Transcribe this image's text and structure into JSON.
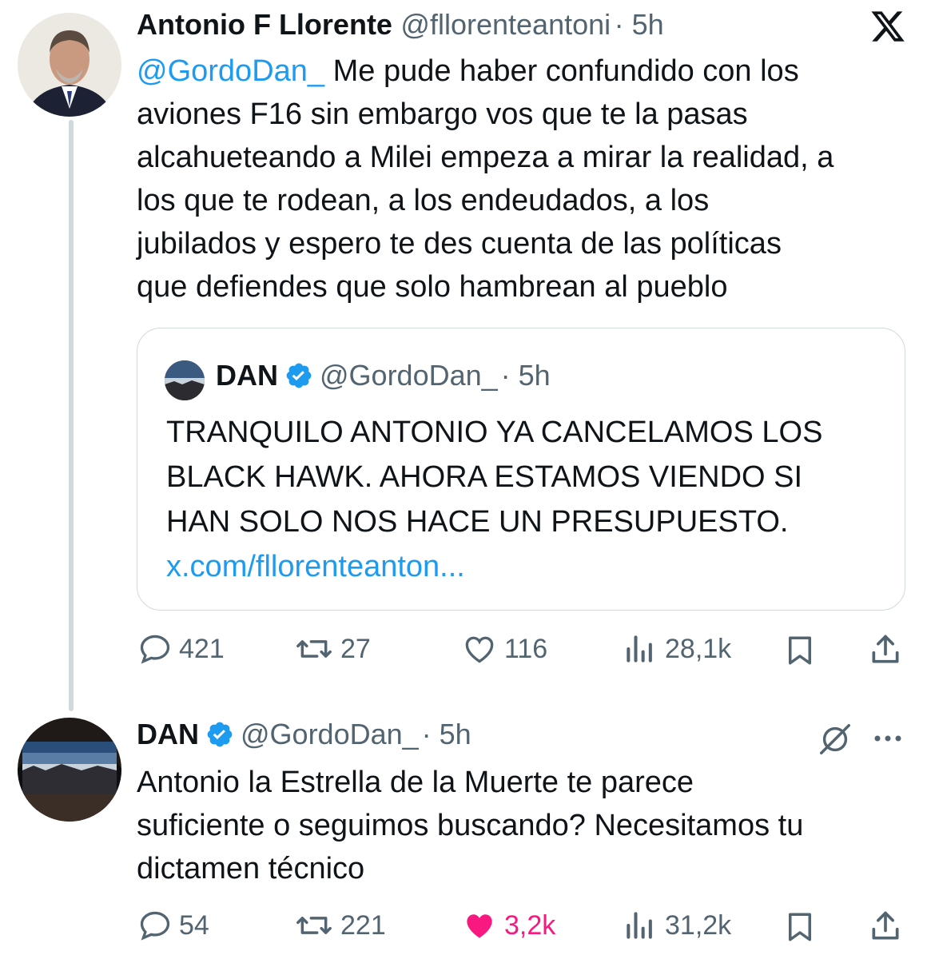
{
  "tweet1": {
    "name": "Antonio F Llorente",
    "handle": "@fllorenteantoni",
    "time": "· 5h",
    "mention": "@GordoDan_",
    "lines": [
      "Me pude haber confundido con los",
      "aviones F16 sin embargo vos que te la pasas",
      "alcahueteando a Milei empeza a mirar la realidad, a",
      "los que te rodean, a los endeudados, a los",
      "jubilados y espero te des cuenta de las políticas",
      "que defiendes que solo hambrean al pueblo"
    ],
    "quote": {
      "name": "DAN",
      "handle": "@GordoDan_",
      "time": "· 5h",
      "lines": [
        "TRANQUILO ANTONIO YA CANCELAMOS LOS",
        "BLACK HAWK. AHORA ESTAMOS VIENDO SI",
        "HAN SOLO NOS HACE UN PRESUPUESTO."
      ],
      "link": "x.com/fllorenteanton..."
    },
    "actions": {
      "replies": "421",
      "reposts": "27",
      "likes": "116",
      "views": "28,1k"
    }
  },
  "tweet2": {
    "name": "DAN",
    "handle": "@GordoDan_",
    "time": "· 5h",
    "lines": [
      "Antonio la Estrella de la Muerte te parece",
      "suficiente o seguimos buscando? Necesitamos tu",
      "dictamen técnico"
    ],
    "actions": {
      "replies": "54",
      "reposts": "221",
      "likes": "3,2k",
      "views": "31,2k"
    }
  },
  "icons": {
    "logo": "x-logo-icon",
    "verified": "verified-badge-icon",
    "reply": "reply-icon",
    "repost": "repost-icon",
    "like": "heart-icon",
    "views": "views-icon",
    "bookmark": "bookmark-icon",
    "share": "share-icon",
    "grok": "grok-icon",
    "more": "more-icon"
  },
  "colors": {
    "accent": "#1d9bf0",
    "like": "#f91880",
    "muted": "#536471",
    "border": "#cfd9de"
  }
}
